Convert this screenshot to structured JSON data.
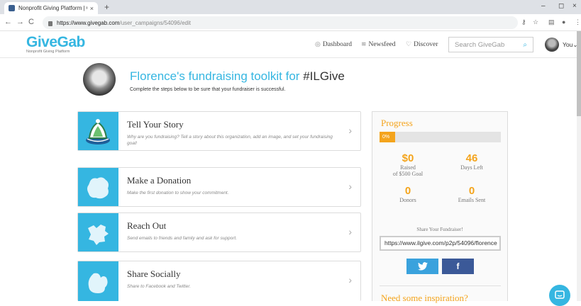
{
  "browser": {
    "tab_title": "Nonprofit Giving Platform | Give",
    "tab_close": "×",
    "new_tab": "+",
    "url_host": "https://www.givegab.com",
    "url_path": "/user_campaigns/54096/edit",
    "controls": {
      "minimize": "–",
      "maximize": "◻",
      "close": "×"
    },
    "nav": {
      "back": "←",
      "forward": "→",
      "reload": "C"
    }
  },
  "site": {
    "logo_text": "GiveGab",
    "logo_subtitle": "Nonprofit Giving Platform",
    "nav": [
      {
        "label": "Dashboard",
        "icon": "dashboard-icon",
        "glyph": "◎"
      },
      {
        "label": "Newsfeed",
        "icon": "newsfeed-icon",
        "glyph": "≋"
      },
      {
        "label": "Discover",
        "icon": "location-pin-icon",
        "glyph": "♡"
      }
    ],
    "search_placeholder": "Search GiveGab",
    "user_label": "You"
  },
  "hero": {
    "title": "Florence's fundraising toolkit for ",
    "hashtag": "#ILGive",
    "subtitle": "Complete the steps below to be sure that your fundraiser is successful."
  },
  "steps": [
    {
      "title": "Tell Your Story",
      "description": "Why are you fundraising? Tell a story about this organization, add an image, and set your fundraising goal!"
    },
    {
      "title": "Make a Donation",
      "description": "Make the first donation to show your commitment."
    },
    {
      "title": "Reach Out",
      "description": "Send emails to friends and family and ask for support."
    },
    {
      "title": "Share Socially",
      "description": "Share to Facebook and Twitter."
    }
  ],
  "progress": {
    "title": "Progress",
    "percent_label": "0%",
    "percent": 0,
    "raised_value": "$0",
    "raised_label_line1": "Raised",
    "raised_label_line2": "of $500 Goal",
    "days_left_value": "46",
    "days_left_label": "Days Left",
    "donors_value": "0",
    "donors_label": "Donors",
    "emails_value": "0",
    "emails_label": "Emails Sent",
    "share_label": "Share Your Fundraiser!",
    "share_url": "https://www.ilgive.com/p2p/54096/florence",
    "twitter_glyph": "🐦",
    "facebook_glyph": "f",
    "inspiration_title": "Need some inspiration?"
  },
  "colors": {
    "brand_blue": "#35b6e1",
    "accent_orange": "#f4a41c",
    "twitter_blue": "#3aa2dd",
    "facebook_blue": "#3b5998"
  }
}
